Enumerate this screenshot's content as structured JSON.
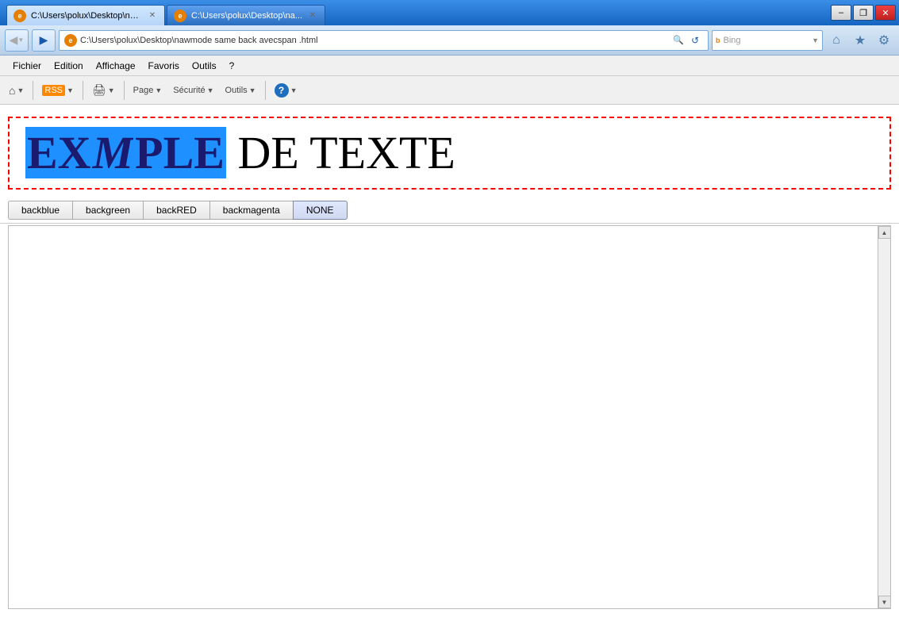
{
  "window": {
    "title": "C:\\Users\\polux\\Desktop\\nawmode same back avecspan .html",
    "tab1_text": "C:\\Users\\polux\\Desktop\\nawmode same back avecspan .html",
    "tab2_text": "C:\\Users\\polux\\Desktop\\na...",
    "controls": {
      "minimize": "–",
      "restore": "❐",
      "close": "✕"
    }
  },
  "address_bar": {
    "url": "C:\\Users\\polux\\Desktop\\nawmode same back avecspan .html",
    "search_placeholder": "Bing"
  },
  "menu": {
    "items": [
      "Fichier",
      "Edition",
      "Affichage",
      "Favoris",
      "Outils",
      "?"
    ]
  },
  "toolbar": {
    "home": "⌂",
    "rss": "RSS",
    "print": "🖨",
    "page": "Page",
    "security": "Sécurité",
    "tools": "Outils",
    "help": "?"
  },
  "demo": {
    "selected_text": "EXEMPLE",
    "italic_letter": "M",
    "remaining_text": " DE TEXTE"
  },
  "buttons": [
    {
      "label": "backblue",
      "active": false
    },
    {
      "label": "backgreen",
      "active": false
    },
    {
      "label": "backRED",
      "active": false
    },
    {
      "label": "backmagenta",
      "active": false
    },
    {
      "label": "NONE",
      "active": true
    }
  ],
  "icons": {
    "back_arrow": "◀",
    "forward_arrow": "▶",
    "search": "🔍",
    "refresh": "↺",
    "home": "⌂",
    "star": "★",
    "gear": "⚙"
  }
}
